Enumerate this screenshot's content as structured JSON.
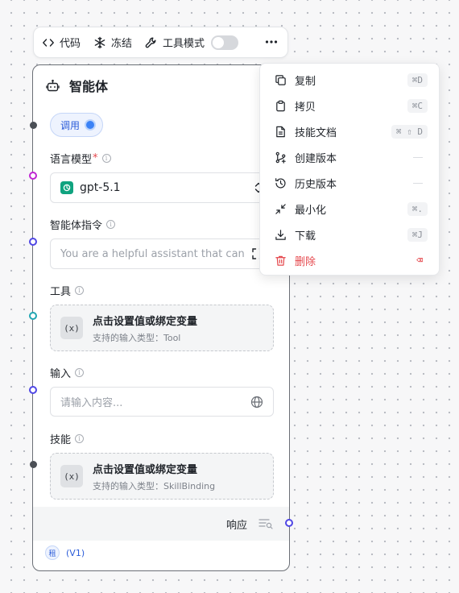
{
  "toolbar": {
    "code_label": "代码",
    "freeze_label": "冻结",
    "tool_mode_label": "工具模式",
    "tool_mode_on": false
  },
  "card": {
    "title": "智能体",
    "invoke_label": "调用",
    "model": {
      "label": "语言模型",
      "required_mark": "*",
      "value": "gpt-5.1"
    },
    "instructions": {
      "label": "智能体指令",
      "placeholder": "You are a helpful assistant that can"
    },
    "tools": {
      "label": "工具",
      "title": "点击设置值或绑定变量",
      "subtitle": "支持的输入类型：Tool"
    },
    "input": {
      "label": "输入",
      "placeholder": "请输入内容..."
    },
    "skills": {
      "label": "技能",
      "title": "点击设置值或绑定变量",
      "subtitle": "支持的输入类型：SkillBinding"
    },
    "response_label": "响应",
    "version": {
      "badge": "租",
      "label": "(V1)"
    }
  },
  "menu": {
    "items": [
      {
        "label": "复制",
        "shortcut": "⌘D",
        "icon": "copy-icon"
      },
      {
        "label": "拷贝",
        "shortcut": "⌘C",
        "icon": "clipboard-icon"
      },
      {
        "label": "技能文档",
        "shortcut": "⌘ ⇧ D",
        "icon": "document-icon"
      },
      {
        "label": "创建版本",
        "shortcut": "",
        "icon": "branch-icon"
      },
      {
        "label": "历史版本",
        "shortcut": "",
        "icon": "history-icon"
      },
      {
        "label": "最小化",
        "shortcut": "⌘.",
        "icon": "minimize-icon"
      },
      {
        "label": "下载",
        "shortcut": "⌘J",
        "icon": "download-icon"
      },
      {
        "label": "删除",
        "shortcut": "⌫",
        "icon": "trash-icon"
      }
    ]
  },
  "colors": {
    "accent": "#3b82f6",
    "danger": "#e5484d",
    "port_invoke": "#4b4f56",
    "port_model": "#c026d3",
    "port_instructions": "#4f46e5",
    "port_tools": "#22a6b3",
    "port_input": "#4f46e5",
    "port_skills": "#4b4f56",
    "port_response": "#4f46e5"
  }
}
